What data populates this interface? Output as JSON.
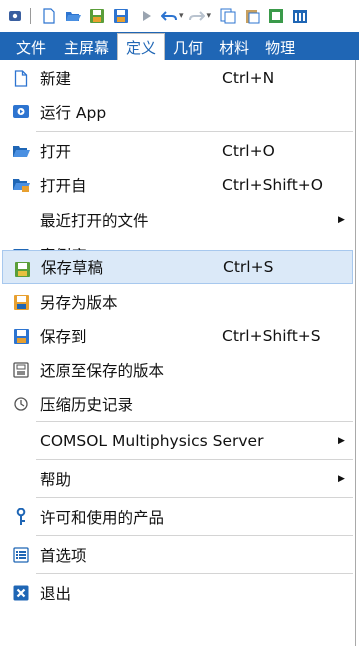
{
  "ribbon": {
    "tabs": [
      "文件",
      "主屏幕",
      "定义",
      "几何",
      "材料",
      "物理"
    ]
  },
  "menu": {
    "new": {
      "label": "新建",
      "shortcut": "Ctrl+N"
    },
    "run_app": {
      "label": "运行 App"
    },
    "open": {
      "label": "打开",
      "shortcut": "Ctrl+O"
    },
    "open_from": {
      "label": "打开自",
      "shortcut": "Ctrl+Shift+O"
    },
    "recent": {
      "label": "最近打开的文件"
    },
    "library": {
      "label": "案例库"
    },
    "save_draft": {
      "label": "保存草稿",
      "shortcut": "Ctrl+S"
    },
    "save_as_version": {
      "label": "另存为版本"
    },
    "save_to": {
      "label": "保存到",
      "shortcut": "Ctrl+Shift+S"
    },
    "revert": {
      "label": "还原至保存的版本"
    },
    "compact_history": {
      "label": "压缩历史记录"
    },
    "server": {
      "label": "COMSOL Multiphysics Server"
    },
    "help": {
      "label": "帮助"
    },
    "licensed": {
      "label": "许可和使用的产品"
    },
    "preferences": {
      "label": "首选项"
    },
    "exit": {
      "label": "退出"
    }
  },
  "colors": {
    "ribbon": "#1f66b5",
    "highlight": "#dbe9f8",
    "accent": "#2d74d0"
  }
}
